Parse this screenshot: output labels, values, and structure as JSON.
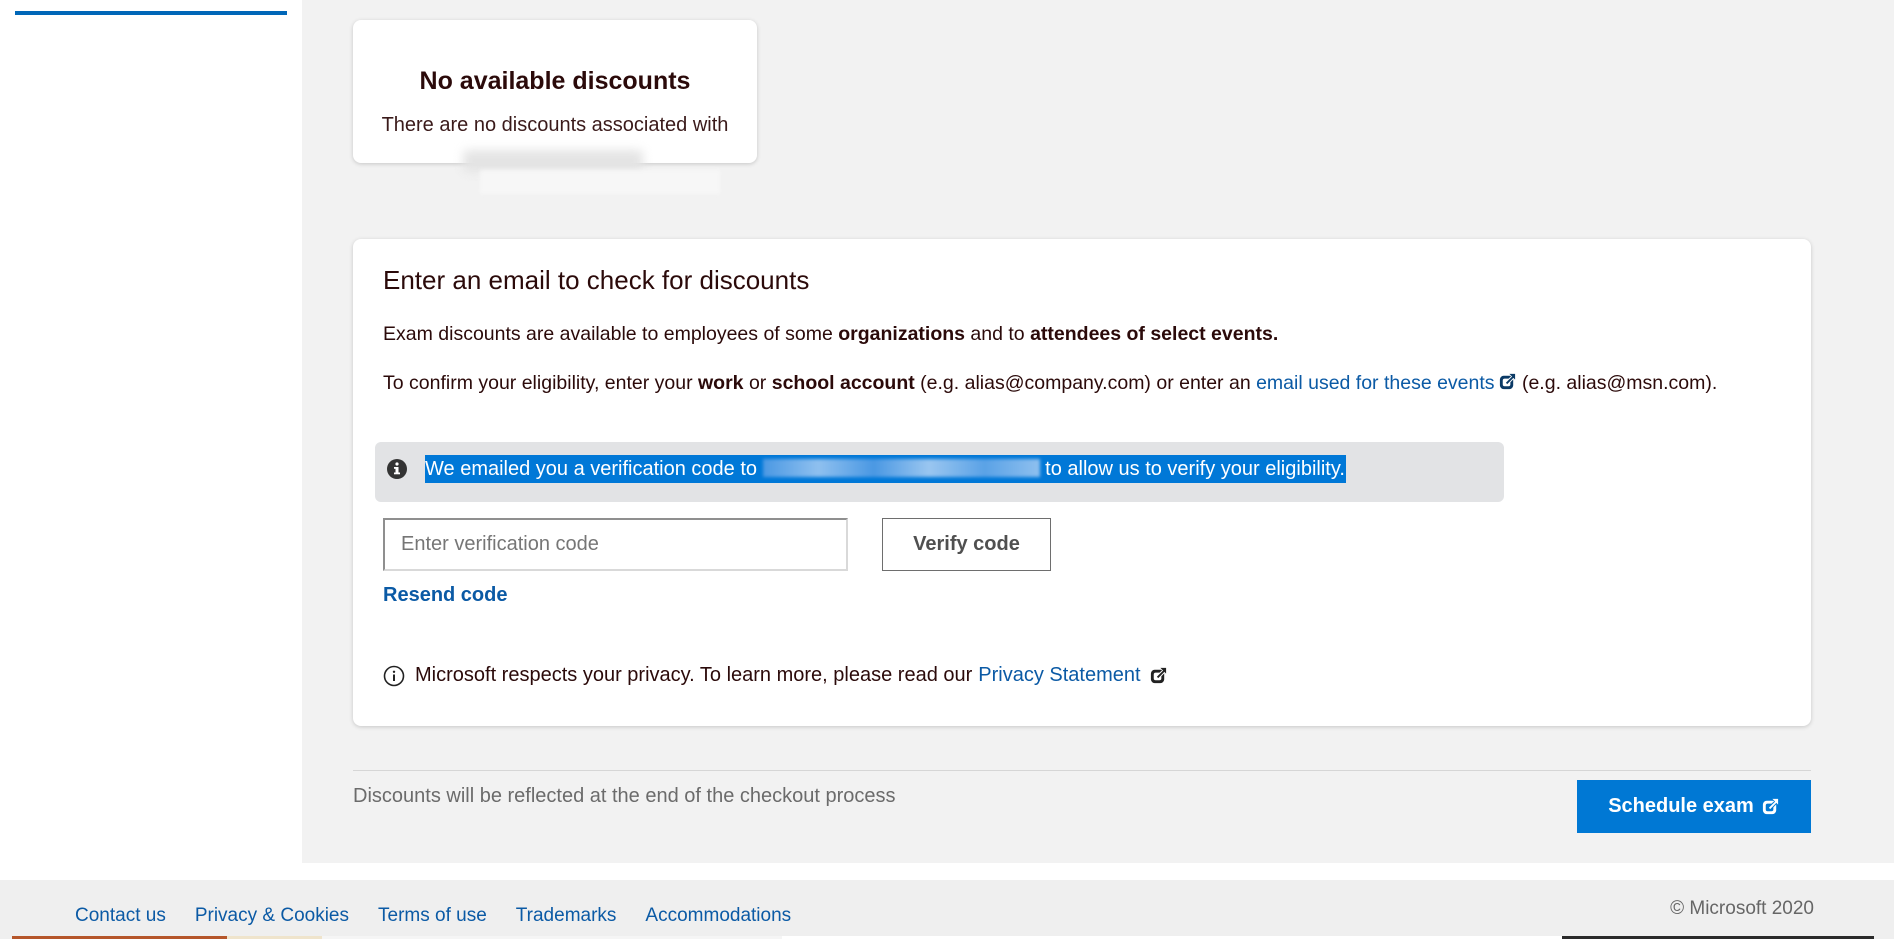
{
  "sidebar": {
    "active_indicator_color": "#0067b8"
  },
  "no_discounts_card": {
    "title": "No available discounts",
    "subtitle": "There are no discounts associated with",
    "email": "[redacted email]"
  },
  "email_card": {
    "heading": "Enter an email to check for discounts",
    "para1": {
      "t1": "Exam discounts are available to employees of some ",
      "b1": "organizations",
      "t2": " and to ",
      "b2": "attendees of select events."
    },
    "para2": {
      "t1": "To confirm your eligibility, enter your ",
      "b1": "work",
      "t2": " or ",
      "b2": "school account",
      "t3": " (e.g. alias@company.com) or enter an ",
      "link": "email used for these events",
      "t4": " (e.g. alias@msn.com)."
    },
    "info": {
      "icon": "info-filled-icon",
      "prefix": "We emailed you a verification code to ",
      "email": "[redacted email]",
      "suffix": " to allow us to verify your eligibility."
    },
    "code_input": {
      "placeholder": "Enter verification code",
      "value": ""
    },
    "verify_button": "Verify code",
    "resend_link": "Resend code",
    "privacy": {
      "icon": "info-outline-icon",
      "text": "Microsoft respects your privacy. To learn more, please read our",
      "link": "Privacy Statement"
    }
  },
  "checkout_note": "Discounts will be reflected at the end of the checkout process",
  "schedule_button": "Schedule exam",
  "footer": {
    "links": [
      "Contact us",
      "Privacy & Cookies",
      "Terms of use",
      "Trademarks",
      "Accommodations"
    ],
    "copyright": "© Microsoft 2020"
  },
  "colors": {
    "accent": "#0078d4",
    "link": "#0b5aa5",
    "selection": "#0078d7",
    "info_bg": "#e2e3e5",
    "page_bg": "#f2f2f2"
  }
}
